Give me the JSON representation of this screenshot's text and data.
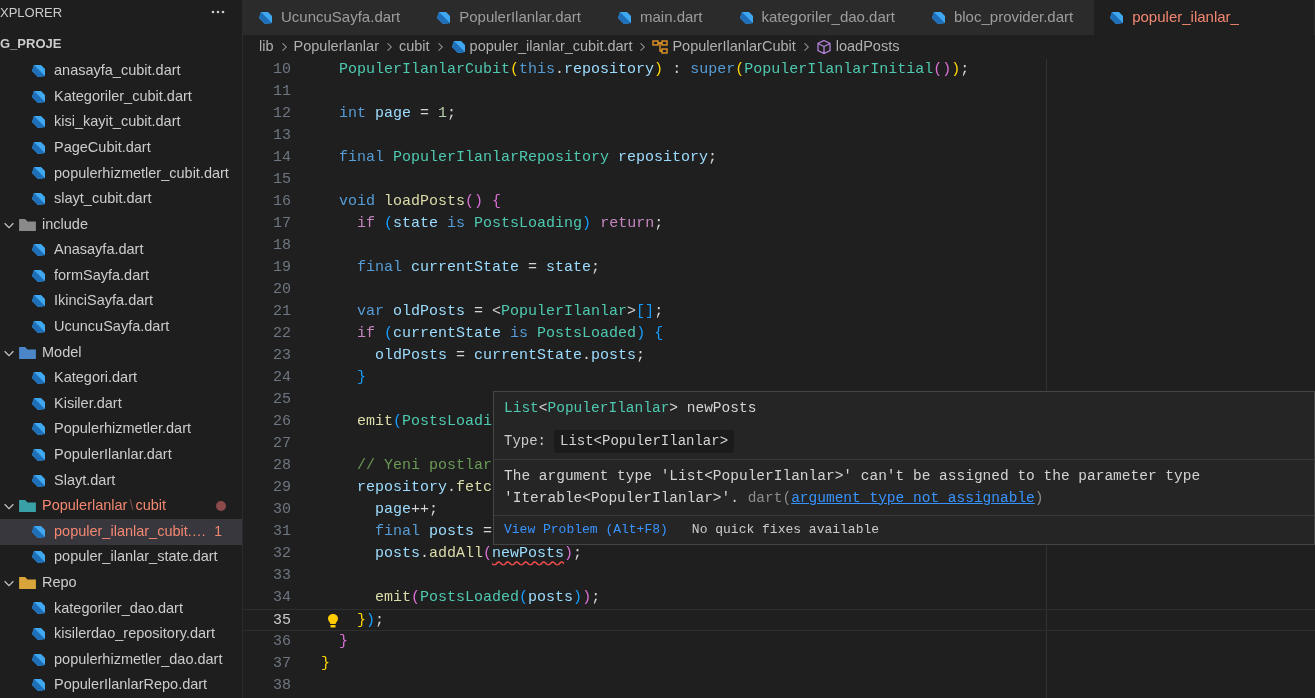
{
  "explorer": {
    "title": "XPLORER",
    "project": "G_PROJE",
    "items": [
      {
        "kind": "file",
        "label": "anasayfa_cubit.dart",
        "selected": false,
        "error": false
      },
      {
        "kind": "file",
        "label": "Kategoriler_cubit.dart",
        "selected": false,
        "error": false
      },
      {
        "kind": "file",
        "label": "kisi_kayit_cubit.dart",
        "selected": false,
        "error": false
      },
      {
        "kind": "file",
        "label": "PageCubit.dart",
        "selected": false,
        "error": false
      },
      {
        "kind": "file",
        "label": "populerhizmetler_cubit.dart",
        "selected": false,
        "error": false
      },
      {
        "kind": "file",
        "label": "slayt_cubit.dart",
        "selected": false,
        "error": false
      },
      {
        "kind": "folder",
        "label": "include",
        "color": "#8a8a8a",
        "expanded": true,
        "error": false,
        "children": [
          {
            "kind": "file",
            "label": "Anasayfa.dart",
            "selected": false,
            "error": false
          },
          {
            "kind": "file",
            "label": "formSayfa.dart",
            "selected": false,
            "error": false
          },
          {
            "kind": "file",
            "label": "IkinciSayfa.dart",
            "selected": false,
            "error": false
          },
          {
            "kind": "file",
            "label": "UcuncuSayfa.dart",
            "selected": false,
            "error": false
          }
        ]
      },
      {
        "kind": "folder",
        "label": "Model",
        "color": "#4a86c8",
        "expanded": true,
        "error": false,
        "children": [
          {
            "kind": "file",
            "label": "Kategori.dart",
            "selected": false,
            "error": false
          },
          {
            "kind": "file",
            "label": "Kisiler.dart",
            "selected": false,
            "error": false
          },
          {
            "kind": "file",
            "label": "Populerhizmetler.dart",
            "selected": false,
            "error": false
          },
          {
            "kind": "file",
            "label": "PopulerIlanlar.dart",
            "selected": false,
            "error": false
          },
          {
            "kind": "file",
            "label": "Slayt.dart",
            "selected": false,
            "error": false
          }
        ]
      },
      {
        "kind": "folder",
        "label": "Populerlanlar",
        "separator": "\\",
        "sublabel": "cubit",
        "color": "#3aa0a8",
        "expanded": true,
        "error": true,
        "children": [
          {
            "kind": "file",
            "label": "populer_ilanlar_cubit.…",
            "selected": true,
            "error": true,
            "problems": "1"
          },
          {
            "kind": "file",
            "label": "populer_ilanlar_state.dart",
            "selected": false,
            "error": false
          }
        ]
      },
      {
        "kind": "folder",
        "label": "Repo",
        "color": "#d9a53a",
        "expanded": true,
        "error": false,
        "children": [
          {
            "kind": "file",
            "label": "kategoriler_dao.dart",
            "selected": false,
            "error": false
          },
          {
            "kind": "file",
            "label": "kisilerdao_repository.dart",
            "selected": false,
            "error": false
          },
          {
            "kind": "file",
            "label": "populerhizmetler_dao.dart",
            "selected": false,
            "error": false
          },
          {
            "kind": "file",
            "label": "PopulerIlanlarRepo.dart",
            "selected": false,
            "error": false
          }
        ]
      }
    ]
  },
  "tabs": [
    {
      "label": "UcuncuSayfa.dart",
      "selected": false,
      "error": false
    },
    {
      "label": "PopulerIlanlar.dart",
      "selected": false,
      "error": false
    },
    {
      "label": "main.dart",
      "selected": false,
      "error": false
    },
    {
      "label": "kategoriler_dao.dart",
      "selected": false,
      "error": false
    },
    {
      "label": "bloc_provider.dart",
      "selected": false,
      "error": false
    },
    {
      "label": "populer_ilanlar_",
      "selected": true,
      "error": true
    }
  ],
  "breadcrumb": [
    {
      "kind": "folder",
      "label": "lib"
    },
    {
      "kind": "folder",
      "label": "Populerlanlar"
    },
    {
      "kind": "folder",
      "label": "cubit"
    },
    {
      "kind": "file",
      "label": "populer_ilanlar_cubit.dart"
    },
    {
      "kind": "class",
      "label": "PopulerIlanlarCubit"
    },
    {
      "kind": "method",
      "label": "loadPosts"
    }
  ],
  "editor": {
    "lines": [
      {
        "number": "10",
        "tokens": [
          {
            "kind": "type",
            "text": "  PopulerIlanlarCubit"
          },
          {
            "kind": "b1",
            "text": "("
          },
          {
            "kind": "kw",
            "text": "this"
          },
          {
            "kind": "p",
            "text": "."
          },
          {
            "kind": "var",
            "text": "repository"
          },
          {
            "kind": "b1",
            "text": ")"
          },
          {
            "kind": "p",
            "text": " : "
          },
          {
            "kind": "kw",
            "text": "super"
          },
          {
            "kind": "b1",
            "text": "("
          },
          {
            "kind": "type",
            "text": "PopulerIlanlarInitial"
          },
          {
            "kind": "b2",
            "text": "()"
          },
          {
            "kind": "b1",
            "text": ")"
          },
          {
            "kind": "p",
            "text": ";"
          }
        ]
      },
      {
        "number": "11"
      },
      {
        "number": "12",
        "tokens": [
          {
            "kind": "kw",
            "text": "  int "
          },
          {
            "kind": "var",
            "text": "page"
          },
          {
            "kind": "p",
            "text": " = "
          },
          {
            "kind": "num",
            "text": "1"
          },
          {
            "kind": "p",
            "text": ";"
          }
        ]
      },
      {
        "number": "13"
      },
      {
        "number": "14",
        "tokens": [
          {
            "kind": "kw",
            "text": "  final "
          },
          {
            "kind": "type",
            "text": "PopulerIlanlarRepository "
          },
          {
            "kind": "var",
            "text": "repository"
          },
          {
            "kind": "p",
            "text": ";"
          }
        ]
      },
      {
        "number": "15"
      },
      {
        "number": "16",
        "tokens": [
          {
            "kind": "kw",
            "text": "  void "
          },
          {
            "kind": "fn",
            "text": "loadPosts"
          },
          {
            "kind": "b2",
            "text": "() "
          },
          {
            "kind": "b2",
            "text": "{"
          }
        ]
      },
      {
        "number": "17",
        "tokens": [
          {
            "kind": "ctrl",
            "text": "    if "
          },
          {
            "kind": "b3",
            "text": "("
          },
          {
            "kind": "var",
            "text": "state "
          },
          {
            "kind": "kw",
            "text": "is "
          },
          {
            "kind": "type",
            "text": "PostsLoading"
          },
          {
            "kind": "b3",
            "text": ") "
          },
          {
            "kind": "ctrl",
            "text": "return"
          },
          {
            "kind": "p",
            "text": ";"
          }
        ]
      },
      {
        "number": "18"
      },
      {
        "number": "19",
        "tokens": [
          {
            "kind": "kw",
            "text": "    final "
          },
          {
            "kind": "var",
            "text": "currentState"
          },
          {
            "kind": "p",
            "text": " = "
          },
          {
            "kind": "var",
            "text": "state"
          },
          {
            "kind": "p",
            "text": ";"
          }
        ]
      },
      {
        "number": "20"
      },
      {
        "number": "21",
        "tokens": [
          {
            "kind": "kw",
            "text": "    var "
          },
          {
            "kind": "var",
            "text": "oldPosts"
          },
          {
            "kind": "p",
            "text": " = <"
          },
          {
            "kind": "type",
            "text": "PopulerIlanlar"
          },
          {
            "kind": "p",
            "text": ">"
          },
          {
            "kind": "b3",
            "text": "[]"
          },
          {
            "kind": "p",
            "text": ";"
          }
        ]
      },
      {
        "number": "22",
        "tokens": [
          {
            "kind": "ctrl",
            "text": "    if "
          },
          {
            "kind": "b3",
            "text": "("
          },
          {
            "kind": "var",
            "text": "currentState "
          },
          {
            "kind": "kw",
            "text": "is "
          },
          {
            "kind": "type",
            "text": "PostsLoaded"
          },
          {
            "kind": "b3",
            "text": ") {"
          }
        ]
      },
      {
        "number": "23",
        "tokens": [
          {
            "kind": "var",
            "text": "      oldPosts"
          },
          {
            "kind": "p",
            "text": " = "
          },
          {
            "kind": "var",
            "text": "currentState"
          },
          {
            "kind": "p",
            "text": "."
          },
          {
            "kind": "var",
            "text": "posts"
          },
          {
            "kind": "p",
            "text": ";"
          }
        ]
      },
      {
        "number": "24",
        "tokens": [
          {
            "kind": "b3",
            "text": "    }"
          }
        ]
      },
      {
        "number": "25"
      },
      {
        "number": "26",
        "tokens": [
          {
            "kind": "fn",
            "text": "    emit"
          },
          {
            "kind": "b3",
            "text": "("
          },
          {
            "kind": "type",
            "text": "PostsLoadi"
          }
        ]
      },
      {
        "number": "27"
      },
      {
        "number": "28",
        "tokens": [
          {
            "kind": "comment",
            "text": "    // Yeni postlar"
          }
        ]
      },
      {
        "number": "29",
        "tokens": [
          {
            "kind": "var",
            "text": "    repository"
          },
          {
            "kind": "p",
            "text": "."
          },
          {
            "kind": "fn",
            "text": "fetc"
          }
        ]
      },
      {
        "number": "30",
        "tokens": [
          {
            "kind": "var",
            "text": "      page"
          },
          {
            "kind": "p",
            "text": "++;"
          }
        ]
      },
      {
        "number": "31",
        "tokens": [
          {
            "kind": "kw",
            "text": "      final "
          },
          {
            "kind": "var",
            "text": "posts"
          },
          {
            "kind": "p",
            "text": " ="
          }
        ]
      },
      {
        "number": "32",
        "tokens": [
          {
            "kind": "var",
            "text": "      posts"
          },
          {
            "kind": "p",
            "text": "."
          },
          {
            "kind": "fn",
            "text": "addAll"
          },
          {
            "kind": "b2",
            "text": "("
          },
          {
            "kind": "err",
            "text": "newPosts"
          },
          {
            "kind": "b2",
            "text": ")"
          },
          {
            "kind": "p",
            "text": ";"
          }
        ]
      },
      {
        "number": "33"
      },
      {
        "number": "34",
        "tokens": [
          {
            "kind": "fn",
            "text": "      emit"
          },
          {
            "kind": "b2",
            "text": "("
          },
          {
            "kind": "type",
            "text": "PostsLoaded"
          },
          {
            "kind": "b3",
            "text": "("
          },
          {
            "kind": "var",
            "text": "posts"
          },
          {
            "kind": "b3",
            "text": ")"
          },
          {
            "kind": "b2",
            "text": ")"
          },
          {
            "kind": "p",
            "text": ";"
          }
        ]
      },
      {
        "number": "35",
        "current": true,
        "lightbulb": true,
        "tokens": [
          {
            "kind": "b1",
            "text": "    }"
          },
          {
            "kind": "b3",
            "text": ")"
          },
          {
            "kind": "p",
            "text": ";"
          }
        ]
      },
      {
        "number": "36",
        "tokens": [
          {
            "kind": "b2",
            "text": "  }"
          }
        ]
      },
      {
        "number": "37",
        "tokens": [
          {
            "kind": "b1",
            "text": "}"
          }
        ]
      },
      {
        "number": "38"
      }
    ]
  },
  "hover": {
    "signature": [
      {
        "kind": "type",
        "text": "List"
      },
      {
        "kind": "p",
        "text": "<"
      },
      {
        "kind": "type",
        "text": "PopulerIlanlar"
      },
      {
        "kind": "p",
        "text": "> newPosts"
      }
    ],
    "type_label": "Type:",
    "type_value": "List<PopulerIlanlar>",
    "message": "The argument type 'List<PopulerIlanlar>' can't be assigned to the parameter type 'Iterable<PopulerIlanlar>'.",
    "source": "dart(",
    "code": "argument_type_not_assignable",
    "source_end": ")",
    "view_problem": "View Problem (Alt+F8)",
    "no_fixes": "No quick fixes available"
  }
}
